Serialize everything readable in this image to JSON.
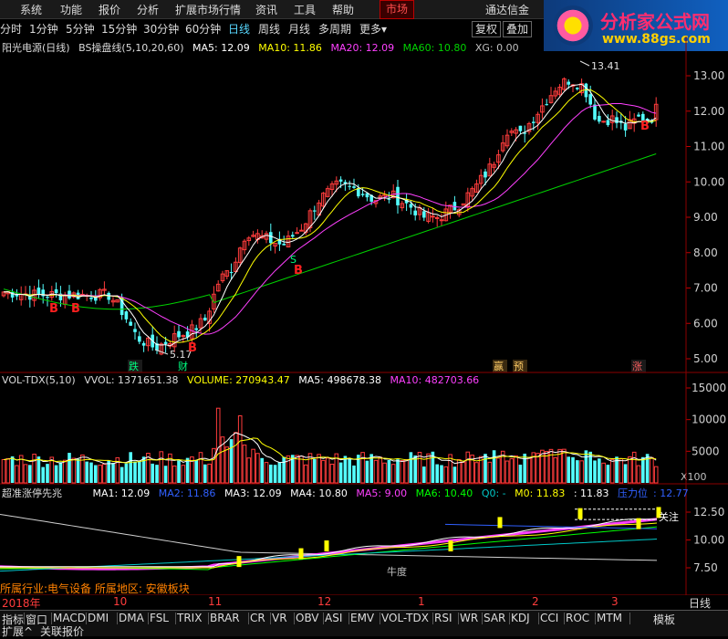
{
  "menu": {
    "items": [
      "系统",
      "功能",
      "报价",
      "分析",
      "扩展市场行情",
      "资讯",
      "工具",
      "帮助"
    ],
    "market_tab": "市场",
    "right_text": "通达信金"
  },
  "brand": {
    "title": "分析家公式网",
    "url": "www.88gs.com"
  },
  "periods": {
    "items": [
      "分时",
      "1分钟",
      "5分钟",
      "15分钟",
      "30分钟",
      "60分钟",
      "日线",
      "周线",
      "月线",
      "多周期",
      "更多"
    ],
    "active": "日线",
    "right": [
      "复权",
      "叠加"
    ]
  },
  "main_panel": {
    "stock": "阳光电源(日线)",
    "indicator": "BS操盘线(5,10,20,60)",
    "ma5": "MA5: 12.09",
    "ma10": "MA10: 11.86",
    "ma20": "MA20: 12.09",
    "ma60": "MA60: 10.80",
    "xg": "XG: 0.00",
    "y_ticks": [
      "13.00",
      "12.00",
      "11.00",
      "10.00",
      "9.00",
      "8.00",
      "7.00",
      "6.00",
      "5.00"
    ],
    "high_label": "13.41",
    "low_label": "5.17",
    "markers": {
      "b": "B",
      "s": "S",
      "fall": "跌",
      "cai": "财",
      "ying": "赢",
      "yu": "预",
      "zhang": "涨"
    }
  },
  "volume_panel": {
    "name": "VOL-TDX(5,10)",
    "vvol": "VVOL: 1371651.38",
    "volume": "VOLUME: 270943.47",
    "ma5": "MA5: 498678.38",
    "ma10": "MA10: 482703.66",
    "y_ticks": [
      "15000",
      "10000",
      "5000"
    ],
    "unit": "X100"
  },
  "signal_panel": {
    "name": "超准涨停先兆",
    "ma1": "MA1: 12.09",
    "ma2": "MA2: 11.86",
    "ma3": "MA3: 12.09",
    "ma4": "MA4: 10.80",
    "ma5": "MA5: 9.00",
    "ma6": "MA6: 10.40",
    "q": "Q0: -",
    "m0": "M0: 11.83",
    "m0b": ": 11.83",
    "press": "压力位",
    "press_val": ": 12.77",
    "y_ticks": [
      "12.50",
      "10.00",
      "7.50"
    ],
    "annotation1": "牛度",
    "annotation2": "关注"
  },
  "info_line": "所属行业:电气设备 所属地区: 安徽板块",
  "x_axis": {
    "labels": [
      "2018年",
      "10",
      "11",
      "12",
      "1",
      "2",
      "3"
    ],
    "right": "日线"
  },
  "tabs": [
    "指标",
    "窗口",
    "MACD",
    "DMI",
    "DMA",
    "FSL",
    "TRIX",
    "BRAR",
    "CR",
    "VR",
    "OBV",
    "ASI",
    "EMV",
    "VOL-TDX",
    "RSI",
    "WR",
    "SAR",
    "KDJ",
    "CCI",
    "ROC",
    "MTM",
    "模板"
  ],
  "tabs2": [
    "扩展^",
    "关联报价"
  ],
  "colors": {
    "up": "#ff3c3c",
    "down": "#54ffff",
    "ma5": "#ffffff",
    "ma10": "#ffff00",
    "ma20": "#ff40ff",
    "ma60": "#00d200",
    "axis": "#8b0000"
  }
}
